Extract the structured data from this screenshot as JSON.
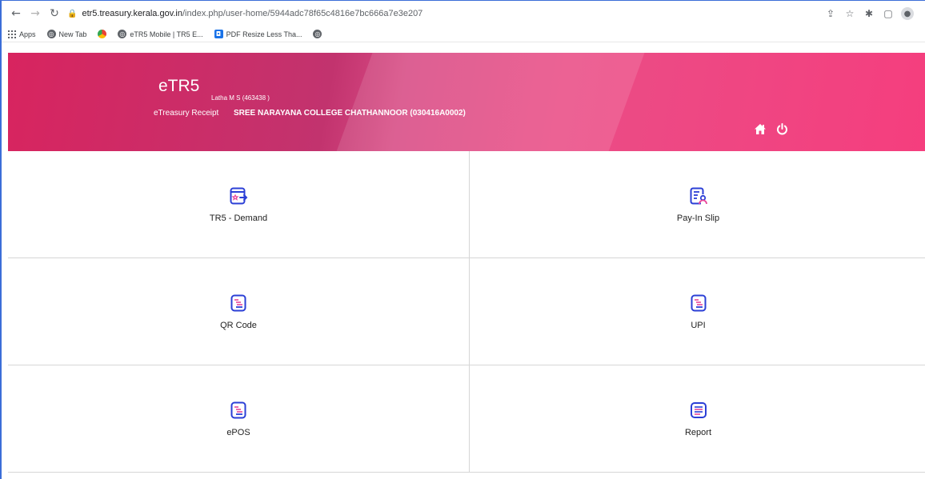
{
  "browser": {
    "url_host": "etr5.treasury.kerala.gov.in",
    "url_path": "/index.php/user-home/5944adc78f65c4816e7bc666a7e3e207",
    "bookmarks": [
      {
        "label": "Apps",
        "icon": "apps-grid-icon"
      },
      {
        "label": "New Tab",
        "icon": "globe-icon"
      },
      {
        "label": "",
        "icon": "chrome-icon"
      },
      {
        "label": "eTR5 Mobile | TR5 E...",
        "icon": "globe-icon"
      },
      {
        "label": "PDF Resize Less Tha...",
        "icon": "pdf-icon"
      },
      {
        "label": "",
        "icon": "globe-icon"
      }
    ]
  },
  "header": {
    "title": "eTR5",
    "subtitle": "eTreasury Receipt",
    "user": "Latha M S (463438 )",
    "office": "SREE NARAYANA COLLEGE CHATHANNOOR (030416A0002)",
    "home_icon": "home-icon",
    "power_icon": "power-icon"
  },
  "tiles": [
    {
      "label": "TR5 - Demand",
      "icon": "demand-icon"
    },
    {
      "label": "Pay-In Slip",
      "icon": "payin-slip-icon"
    },
    {
      "label": "QR Code",
      "icon": "qr-document-icon"
    },
    {
      "label": "UPI",
      "icon": "upi-document-icon"
    },
    {
      "label": "ePOS",
      "icon": "epos-document-icon"
    },
    {
      "label": "Report",
      "icon": "report-icon"
    }
  ],
  "colors": {
    "banner_start": "#d8245f",
    "banner_end": "#f53e7e",
    "icon_blue": "#2b3fd6",
    "icon_pink": "#e8459a"
  }
}
